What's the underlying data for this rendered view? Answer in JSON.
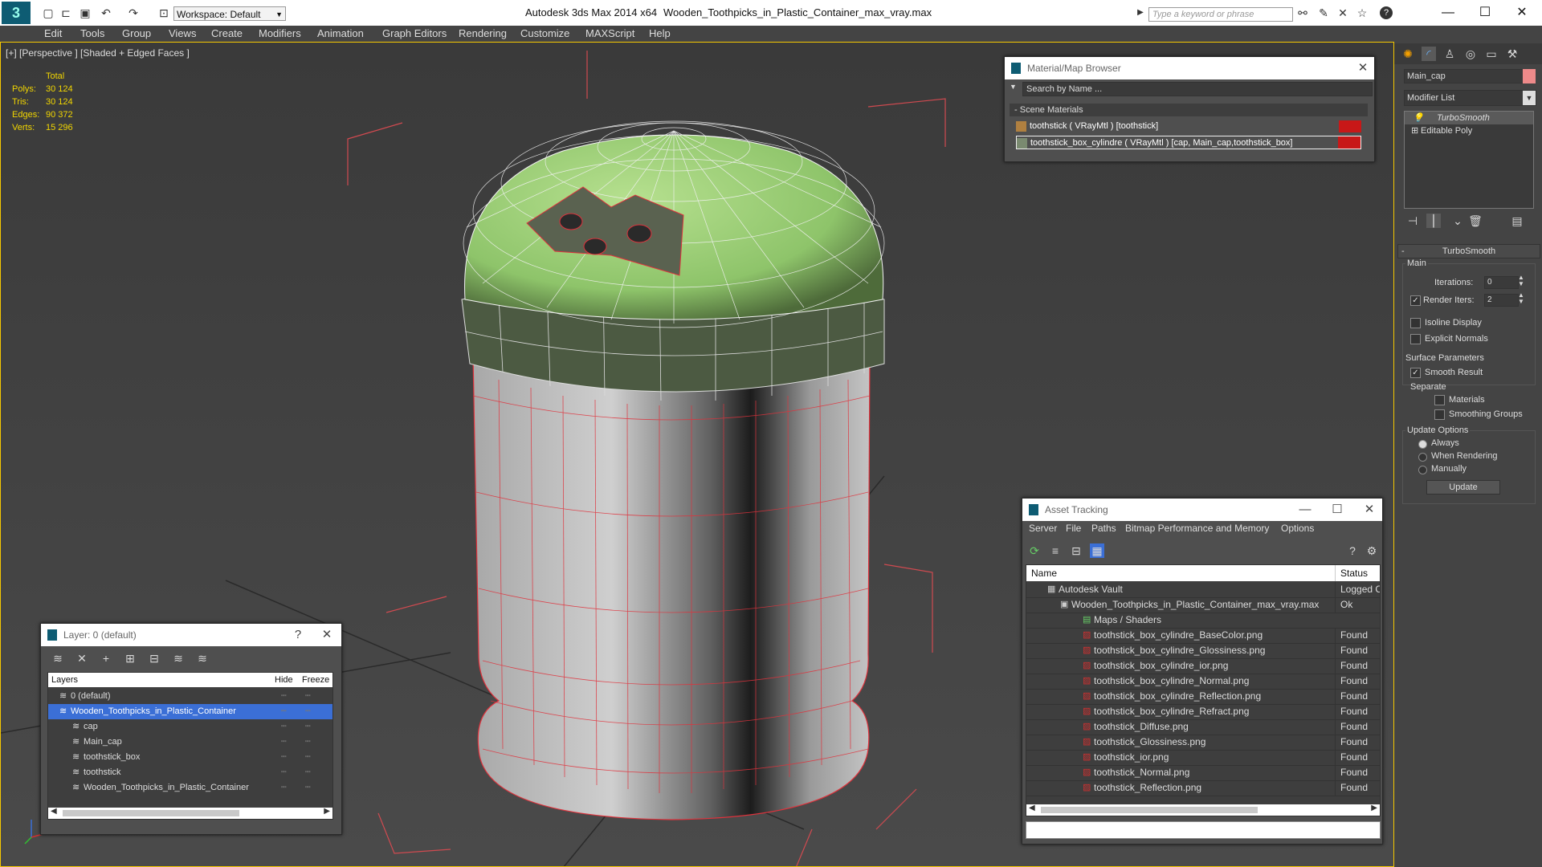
{
  "window": {
    "app_title": "Autodesk 3ds Max  2014 x64",
    "file_title": "Wooden_Toothpicks_in_Plastic_Container_max_vray.max",
    "workspace": "Workspace: Default",
    "search_placeholder": "Type a keyword or phrase"
  },
  "menu": [
    "Edit",
    "Tools",
    "Group",
    "Views",
    "Create",
    "Modifiers",
    "Animation",
    "Graph Editors",
    "Rendering",
    "Customize",
    "MAXScript",
    "Help"
  ],
  "viewport": {
    "label": "[+] [Perspective ] [Shaded + Edged Faces ]",
    "stats": {
      "header": "Total",
      "rows": [
        [
          "Polys:",
          "30 124"
        ],
        [
          "Tris:",
          "30 124"
        ],
        [
          "Edges:",
          "90 372"
        ],
        [
          "Verts:",
          "15 296"
        ]
      ]
    }
  },
  "material_browser": {
    "title": "Material/Map Browser",
    "search": "Search by Name ...",
    "section": "Scene Materials",
    "items": [
      "toothstick  ( VRayMtl ) [toothstick]",
      "toothstick_box_cylindre  ( VRayMtl ) [cap, Main_cap,toothstick_box]"
    ]
  },
  "layer_window": {
    "title": "Layer: 0 (default)",
    "help": "?",
    "columns": [
      "Layers",
      "Hide",
      "Freeze"
    ],
    "rows": [
      {
        "name": "0 (default)",
        "level": 1
      },
      {
        "name": "Wooden_Toothpicks_in_Plastic_Container",
        "level": 1,
        "selected": true
      },
      {
        "name": "cap",
        "level": 2
      },
      {
        "name": "Main_cap",
        "level": 2
      },
      {
        "name": "toothstick_box",
        "level": 2
      },
      {
        "name": "toothstick",
        "level": 2
      },
      {
        "name": "Wooden_Toothpicks_in_Plastic_Container",
        "level": 2
      }
    ]
  },
  "asset_tracking": {
    "title": "Asset Tracking",
    "menu": [
      "Server",
      "File",
      "Paths",
      "Bitmap Performance and Memory",
      "Options"
    ],
    "columns": [
      "Name",
      "Status"
    ],
    "rows": [
      {
        "name": "Autodesk Vault",
        "status": "Logged C",
        "level": 1
      },
      {
        "name": "Wooden_Toothpicks_in_Plastic_Container_max_vray.max",
        "status": "Ok",
        "level": 2
      },
      {
        "name": "Maps / Shaders",
        "status": "",
        "level": 3
      },
      {
        "name": "toothstick_box_cylindre_BaseColor.png",
        "status": "Found",
        "level": 4
      },
      {
        "name": "toothstick_box_cylindre_Glossiness.png",
        "status": "Found",
        "level": 4
      },
      {
        "name": "toothstick_box_cylindre_ior.png",
        "status": "Found",
        "level": 4
      },
      {
        "name": "toothstick_box_cylindre_Normal.png",
        "status": "Found",
        "level": 4
      },
      {
        "name": "toothstick_box_cylindre_Reflection.png",
        "status": "Found",
        "level": 4
      },
      {
        "name": "toothstick_box_cylindre_Refract.png",
        "status": "Found",
        "level": 4
      },
      {
        "name": "toothstick_Diffuse.png",
        "status": "Found",
        "level": 4
      },
      {
        "name": "toothstick_Glossiness.png",
        "status": "Found",
        "level": 4
      },
      {
        "name": "toothstick_ior.png",
        "status": "Found",
        "level": 4
      },
      {
        "name": "toothstick_Normal.png",
        "status": "Found",
        "level": 4
      },
      {
        "name": "toothstick_Reflection.png",
        "status": "Found",
        "level": 4
      }
    ]
  },
  "command_panel": {
    "object_name": "Main_cap",
    "object_color": "#ee8a8a",
    "modifier_list": "Modifier List",
    "stack": [
      "TurboSmooth",
      "Editable Poly"
    ],
    "rollout": "TurboSmooth",
    "main": "Main",
    "iterations_label": "Iterations:",
    "iterations": "0",
    "render_iters_label": "Render Iters:",
    "render_iters": "2",
    "isoline": "Isoline Display",
    "explicit": "Explicit Normals",
    "surface": "Surface Parameters",
    "smooth": "Smooth Result",
    "separate": "Separate",
    "materials": "Materials",
    "smoothing": "Smoothing Groups",
    "update_options": "Update Options",
    "always": "Always",
    "when_rendering": "When Rendering",
    "manually": "Manually",
    "update_btn": "Update"
  },
  "colors": {
    "selection": "#f6c800",
    "stats": "#f2d600",
    "wire_red": "#e0323c",
    "cap_green": "#9fd27a"
  }
}
